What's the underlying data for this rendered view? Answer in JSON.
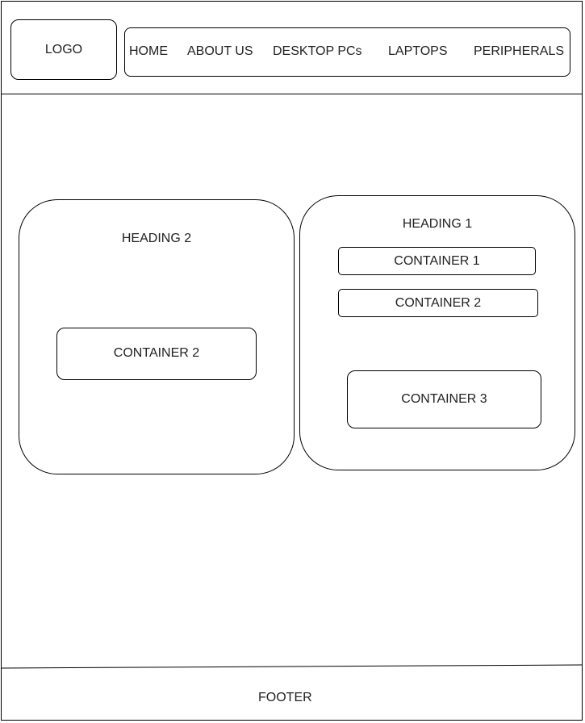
{
  "header": {
    "logo": "LOGO",
    "nav": {
      "items": [
        {
          "label": "HOME"
        },
        {
          "label": "ABOUT US"
        },
        {
          "label": "DESKTOP PCs"
        },
        {
          "label": "LAPTOPS"
        },
        {
          "label": "PERIPHERALS"
        }
      ]
    }
  },
  "main": {
    "left_panel": {
      "heading": "HEADING 2",
      "container": "CONTAINER 2"
    },
    "right_panel": {
      "heading": "HEADING 1",
      "containers": [
        {
          "label": "CONTAINER 1"
        },
        {
          "label": "CONTAINER 2"
        },
        {
          "label": "CONTAINER 3"
        }
      ]
    }
  },
  "footer": {
    "label": "FOOTER"
  }
}
